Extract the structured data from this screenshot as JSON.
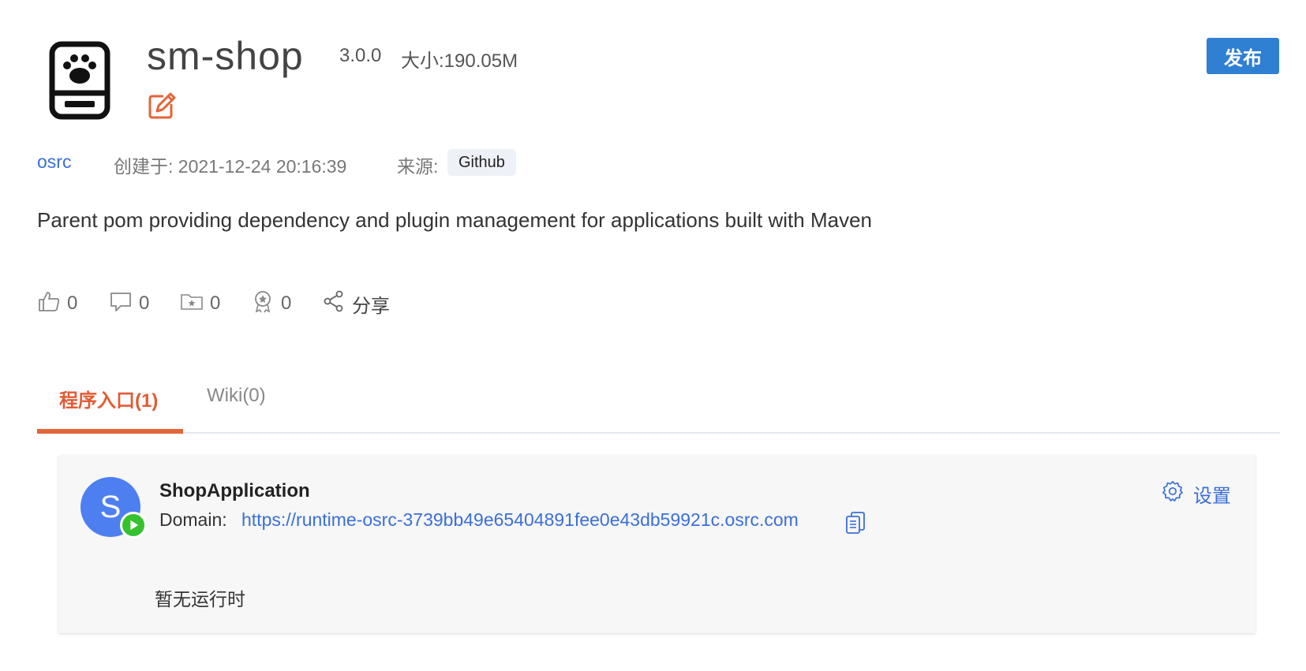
{
  "header": {
    "title": "sm-shop",
    "version": "3.0.0",
    "size": "大小:190.05M",
    "publish_label": "发布"
  },
  "meta": {
    "author": "osrc",
    "created": "创建于: 2021-12-24 20:16:39",
    "source_label": "来源:",
    "source_value": "Github"
  },
  "description": "Parent pom providing dependency and plugin management for applications built with Maven",
  "stats": {
    "likes": "0",
    "comments": "0",
    "favorites": "0",
    "awards": "0",
    "share_label": "分享"
  },
  "tabs": [
    {
      "label": "程序入口(1)",
      "active": true
    },
    {
      "label": "Wiki(0)",
      "active": false
    }
  ],
  "app_card": {
    "avatar_letter": "S",
    "name": "ShopApplication",
    "domain_label": "Domain:",
    "domain_url": "https://runtime-osrc-3739bb49e65404891fee0e43db59921c.osrc.com",
    "settings_label": "设置",
    "runtime_empty": "暂无运行时"
  },
  "icons": {
    "logo": "paw-device-icon",
    "edit": "edit-icon",
    "like": "thumbs-up-icon",
    "comment": "comment-icon",
    "favorite": "folder-star-icon",
    "award": "award-icon",
    "share": "share-icon",
    "play": "play-icon",
    "copy": "copy-icon",
    "settings": "gear-icon"
  },
  "colors": {
    "accent_orange": "#e3653a",
    "link_blue": "#3a6fd8",
    "publish_blue": "#2f7fd2",
    "play_green": "#35c22e",
    "avatar_blue": "#4d7ff0"
  }
}
